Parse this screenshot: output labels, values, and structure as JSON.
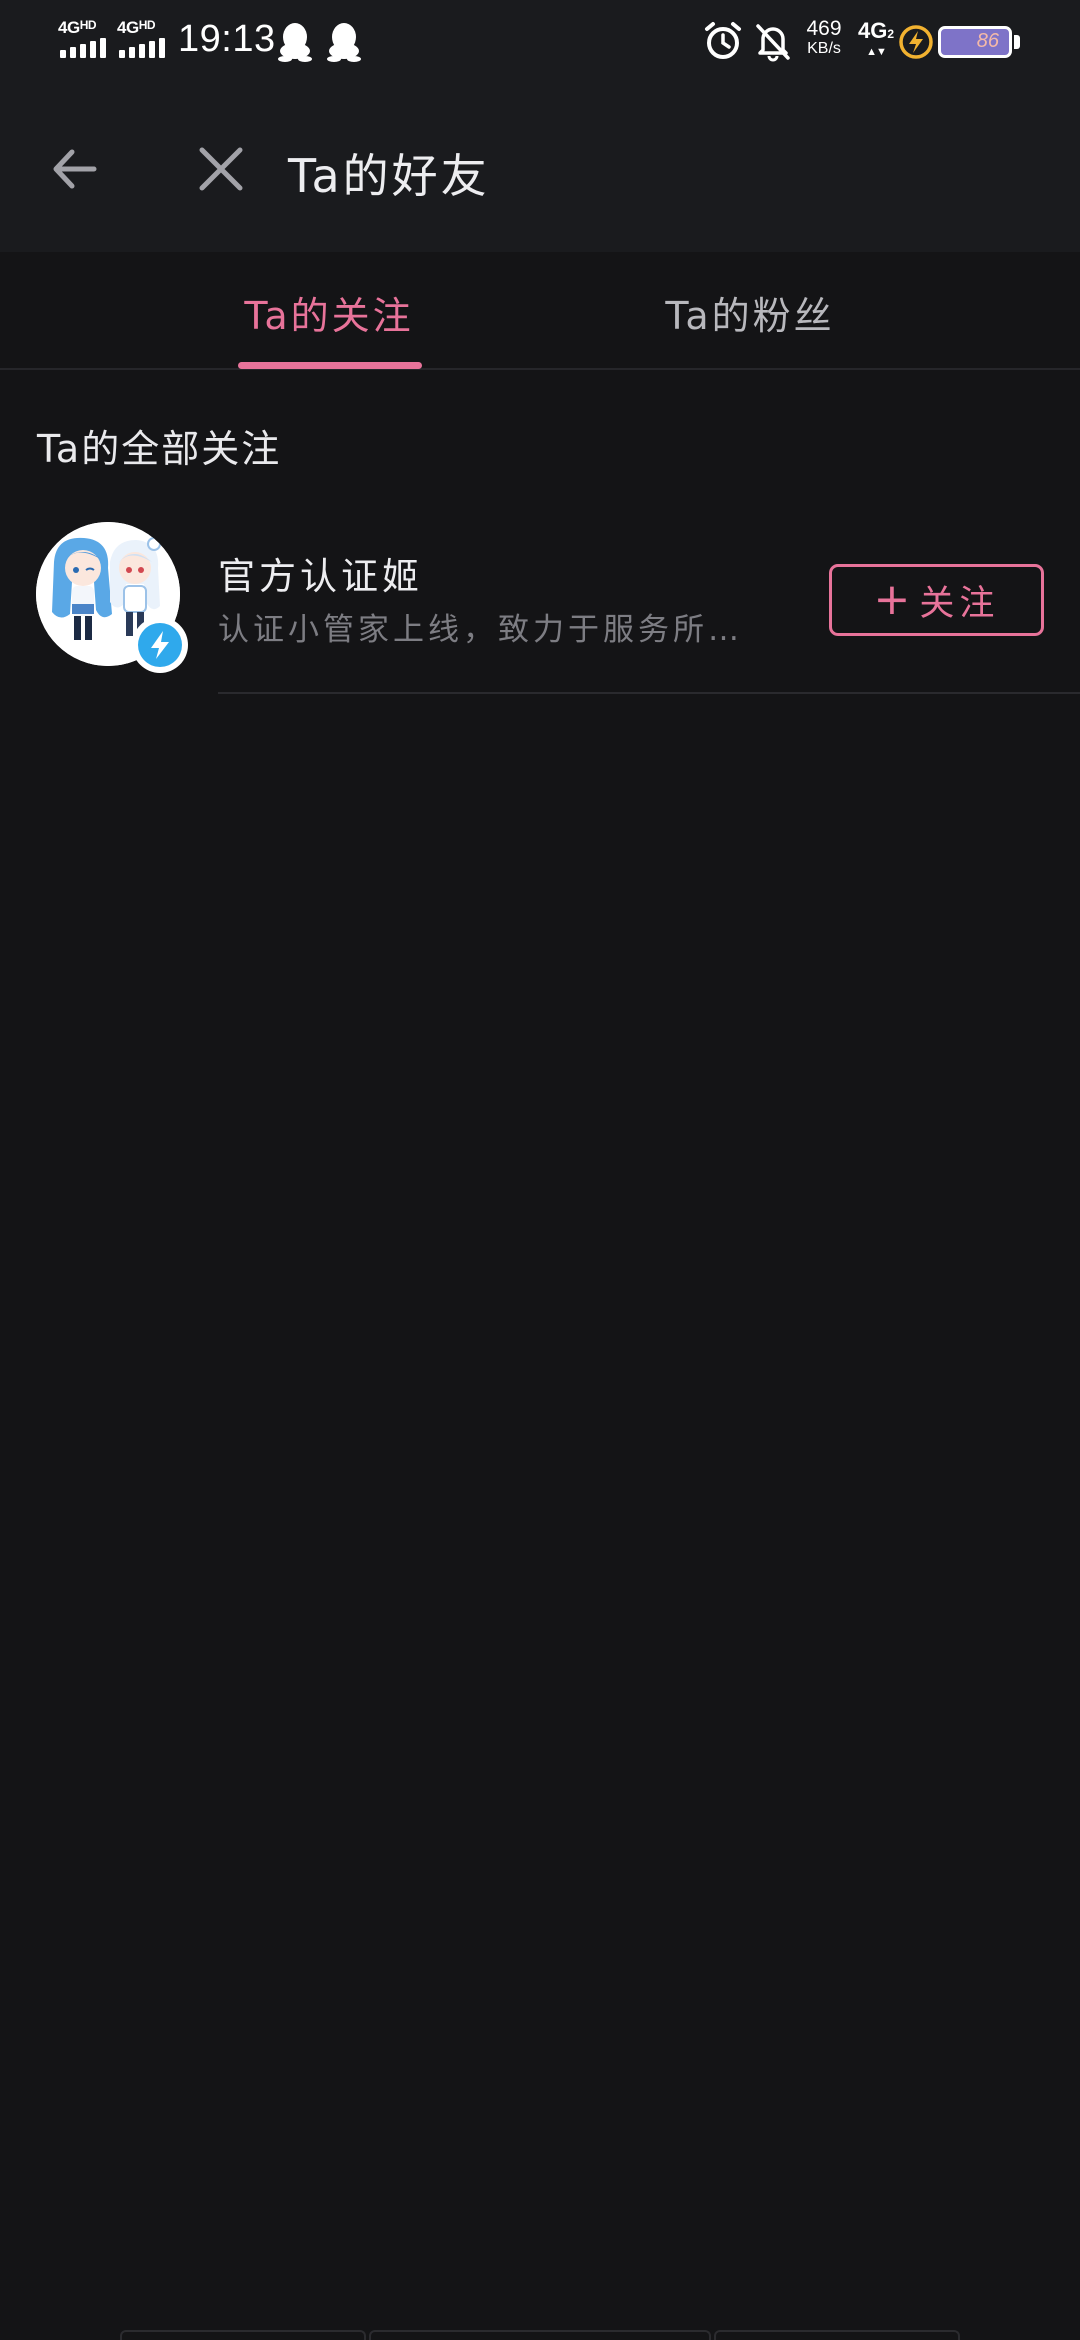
{
  "status_bar": {
    "signal1": "4G",
    "signal1_sup": "HD",
    "signal2": "4G",
    "signal2_sup": "HD",
    "time": "19:13",
    "net_speed_value": "469",
    "net_speed_unit": "KB/s",
    "network": "4G",
    "network_sub": "2",
    "battery_level": "86"
  },
  "header": {
    "title": "Ta的好友"
  },
  "tabs": [
    {
      "label": "Ta的关注",
      "active": true
    },
    {
      "label": "Ta的粉丝",
      "active": false
    }
  ],
  "main": {
    "section_title": "Ta的全部关注",
    "users": [
      {
        "name": "官方认证姬",
        "description": "认证小管家上线，致力于服务所有UP主",
        "follow_label": "关注",
        "verified": true
      }
    ]
  },
  "colors": {
    "accent": "#e8739a",
    "background": "#141416",
    "header_bg": "#1a1b1e",
    "verify_badge": "#2fa9ec"
  }
}
